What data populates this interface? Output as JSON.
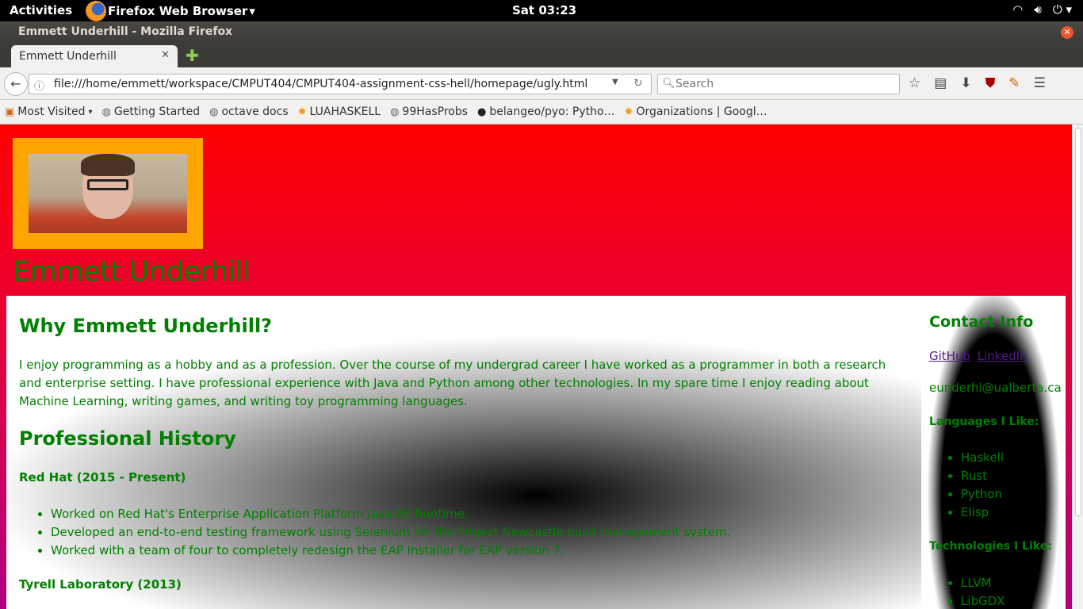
{
  "desktop": {
    "activities": "Activities",
    "app_menu": "Firefox Web Browser",
    "clock": "Sat 03:23"
  },
  "window": {
    "title": "Emmett Underhill - Mozilla Firefox"
  },
  "tabs": [
    {
      "label": "Emmett Underhill"
    }
  ],
  "navbar": {
    "url": "file:///home/emmett/workspace/CMPUT404/CMPUT404-assignment-css-hell/homepage/ugly.html",
    "search_placeholder": "Search"
  },
  "bookmarks": [
    {
      "label": "Most Visited",
      "icon": "folder-icon"
    },
    {
      "label": "Getting Started",
      "icon": "globe-icon"
    },
    {
      "label": "octave docs",
      "icon": "globe-icon"
    },
    {
      "label": "LUAHASKELL",
      "icon": "sun-icon"
    },
    {
      "label": "99HasProbs",
      "icon": "globe-icon"
    },
    {
      "label": "belangeo/pyo: Pytho…",
      "icon": "github-icon"
    },
    {
      "label": "Organizations | Googl…",
      "icon": "sun-icon"
    }
  ],
  "page": {
    "name": "Emmett Underhill",
    "why_heading": "Why Emmett Underhill?",
    "intro": "I enjoy programming as a hobby and as a profession. Over the course of my undergrad career I have worked as a programmer in both a research and enterprise setting. I have professional experience with Java and Python among other technologies. In my spare time I enjoy reading about Machine Learning, writing games, and writing toy programming languages.",
    "history_heading": "Professional History",
    "jobs": [
      {
        "title": "Red Hat (2015 - Present)",
        "items": [
          "Worked on Red Hat's Enterprise Application Platform Java EE Runtime.",
          "Developed an end-to-end testing framework using Selenium for the Project Newcastle build management system.",
          "Worked with a team of four to completely redesign the EAP Installer for EAP version 7."
        ]
      },
      {
        "title": "Tyrell Laboratory (2013)",
        "items": []
      }
    ],
    "contact": {
      "heading": "Contact Info",
      "github": "GitHub",
      "linkedin": "LinkedIn",
      "email": "eunderhi@ualberta.ca"
    },
    "languages_heading": "Languages I Like:",
    "languages": [
      "Haskell",
      "Rust",
      "Python",
      "Elisp"
    ],
    "technologies_heading": "Technologies I Like:",
    "technologies": [
      "LLVM",
      "LibGDX"
    ]
  },
  "colors": {
    "text_green": "#008000",
    "photo_frame": "#ffa500",
    "header_red": "#ff0000",
    "link_purple": "#551a8b"
  }
}
